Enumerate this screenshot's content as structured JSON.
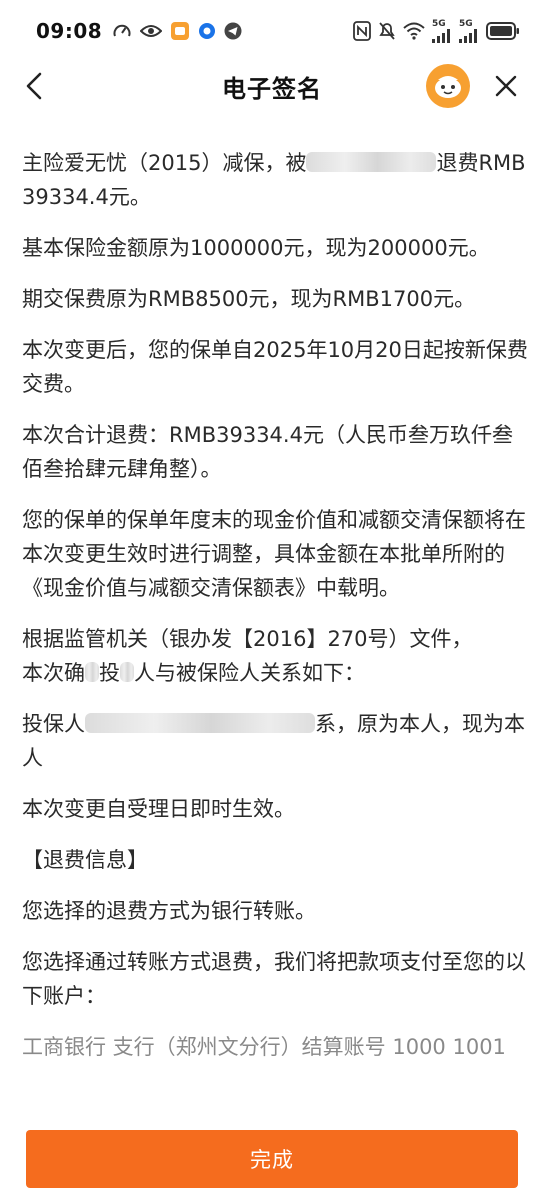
{
  "status_bar": {
    "time": "09:08",
    "network_1": "5G",
    "network_2": "5G",
    "icons": [
      "speedometer-icon",
      "eye-icon",
      "app-notification-icon",
      "browser-icon",
      "telegram-icon",
      "nfc-icon",
      "mute-icon",
      "wifi-icon",
      "signal-icon",
      "battery-icon"
    ]
  },
  "nav": {
    "title": "电子签名",
    "back_icon": "chevron-left-icon",
    "avatar_icon": "assistant-avatar-icon",
    "close_icon": "close-icon"
  },
  "content": {
    "p1_start": "主险爱无忧（2015）减保，被",
    "p1_end": "退费RMB39334.4元。",
    "p2": "基本保险金额原为1000000元，现为200000元。",
    "p3": "期交保费原为RMB8500元，现为RMB1700元。",
    "p4": "本次变更后，您的保单自2025年10月20日起按新保费交费。",
    "p5": "本次合计退费：RMB39334.4元（人民币叁万玖仟叁佰叁拾肆元肆角整）。",
    "p6": "您的保单的保单年度末的现金价值和减额交清保额将在本次变更生效时进行调整，具体金额在本批单所附的《现金价值与减额交清保额表》中载明。",
    "p7_line1": "根据监管机关（银办发【2016】270号）文件，",
    "p7_a": "本次确",
    "p7_b": "投",
    "p7_c": "人与被保险人关系如下：",
    "p8_start": "投保人",
    "p8_end": "系，原为本人，现为本人",
    "p9": "本次变更自受理日即时生效。",
    "p10": "【退费信息】",
    "p11": "您选择的退费方式为银行转账。",
    "p12": "您选择通过转账方式退费，我们将把款项支付至您的以下账户：",
    "p13_partial": "工商银行 支行（郑州文分行）结算账号 1000 1001"
  },
  "footer": {
    "done_label": "完成"
  },
  "colors": {
    "accent": "#f56c1e",
    "avatar": "#f7a031",
    "text": "#2a2a2a"
  }
}
